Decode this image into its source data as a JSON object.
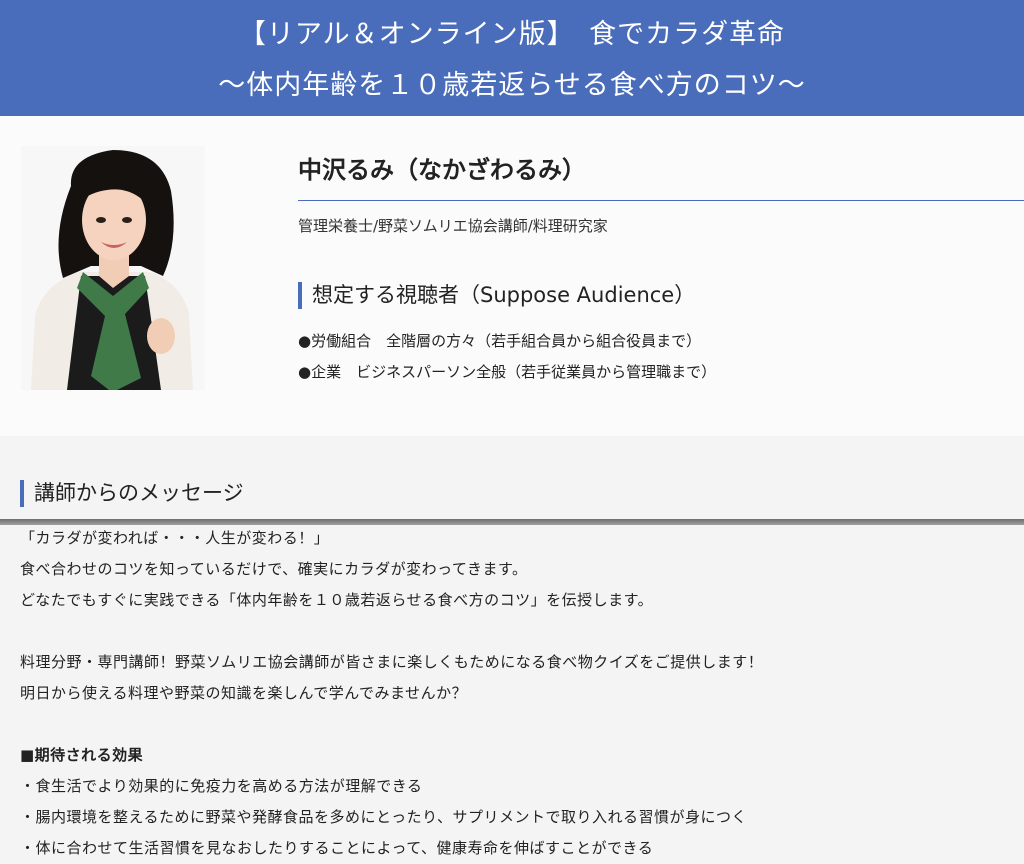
{
  "header": {
    "line1": "【リアル＆オンライン版】　食でカラダ革命",
    "line2": "～体内年齢を１０歳若返らせる食べ方のコツ～",
    "bg_color": "#4a6dbb"
  },
  "profile": {
    "name": "中沢るみ（なかざわるみ）",
    "title": "管理栄養士/野菜ソムリエ協会講師/料理研究家",
    "audience_heading": "想定する視聴者（Suppose Audience）",
    "audience_items": [
      "●労働組合　全階層の方々（若手組合員から組合役員まで）",
      "●企業　ビジネスパーソン全般（若手従業員から管理職まで）"
    ]
  },
  "message": {
    "heading": "講師からのメッセージ",
    "lines": [
      "「カラダが変われば・・・人生が変わる！」",
      "食べ合わせのコツを知っているだけで、確実にカラダが変わってきます。",
      "どなたでもすぐに実践できる「体内年齢を１０歳若返らせる食べ方のコツ」を伝授します。",
      "料理分野・専門講師！野菜ソムリエ協会講師が皆さまに楽しくもためになる食べ物クイズをご提供します！",
      "明日から使える料理や野菜の知識を楽しんで学んでみませんか？"
    ],
    "effects_heading": "■期待される効果",
    "effects": [
      "・食生活でより効果的に免疫力を高める方法が理解できる",
      "・腸内環境を整えるために野菜や発酵食品を多めにとったり、サプリメントで取り入れる習慣が身につく",
      "・体に合わせて生活習慣を見なおしたりすることによって、健康寿命を伸ばすことができる"
    ]
  }
}
